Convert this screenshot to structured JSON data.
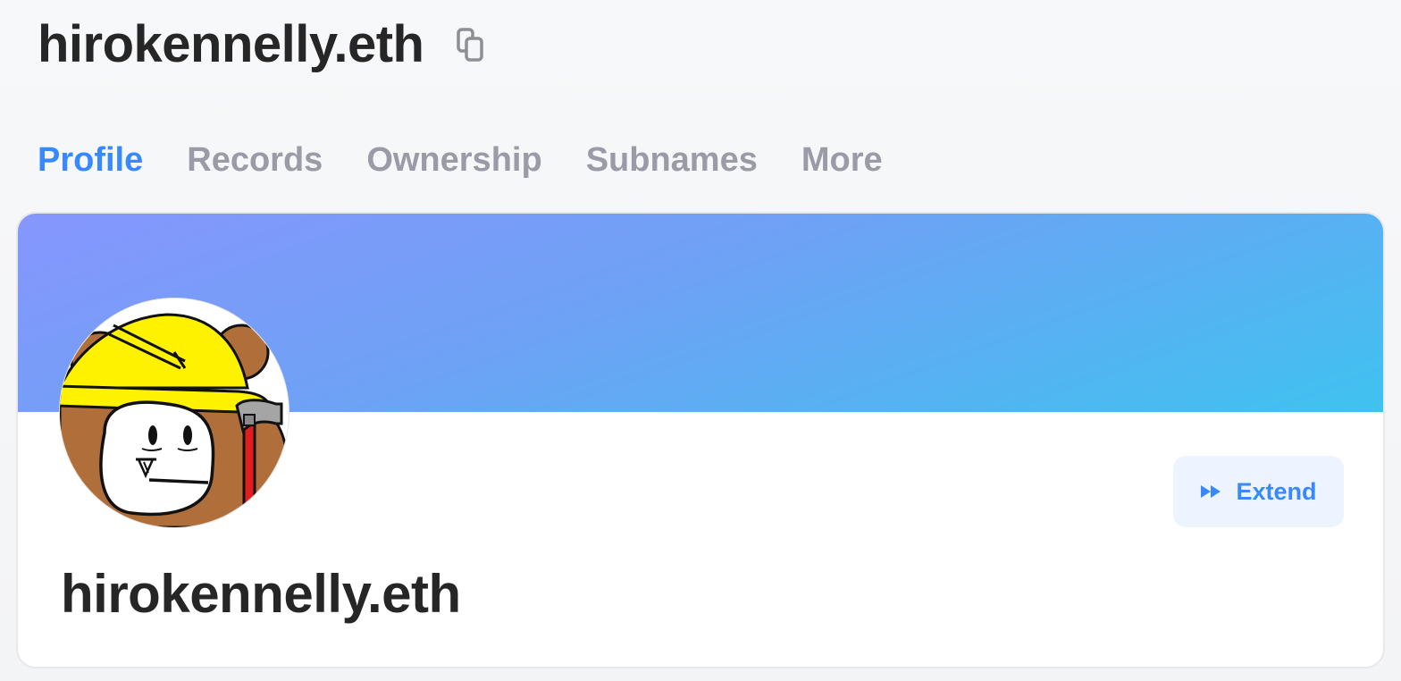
{
  "header": {
    "name": "hirokennelly.eth",
    "copy_icon": "copy-icon"
  },
  "tabs": [
    {
      "label": "Profile",
      "active": true
    },
    {
      "label": "Records",
      "active": false
    },
    {
      "label": "Ownership",
      "active": false
    },
    {
      "label": "Subnames",
      "active": false
    },
    {
      "label": "More",
      "active": false
    }
  ],
  "profile": {
    "name": "hirokennelly.eth",
    "extend_label": "Extend",
    "extend_icon": "fast-forward-icon",
    "avatar": "bear-construction-helmet-hammer-avatar"
  },
  "colors": {
    "accent": "#3889ff",
    "tab_inactive": "#9b9ba7",
    "text": "#262626",
    "banner_start": "#8696fd",
    "banner_end": "#3fc2ef",
    "extend_bg": "#eef4ff"
  }
}
